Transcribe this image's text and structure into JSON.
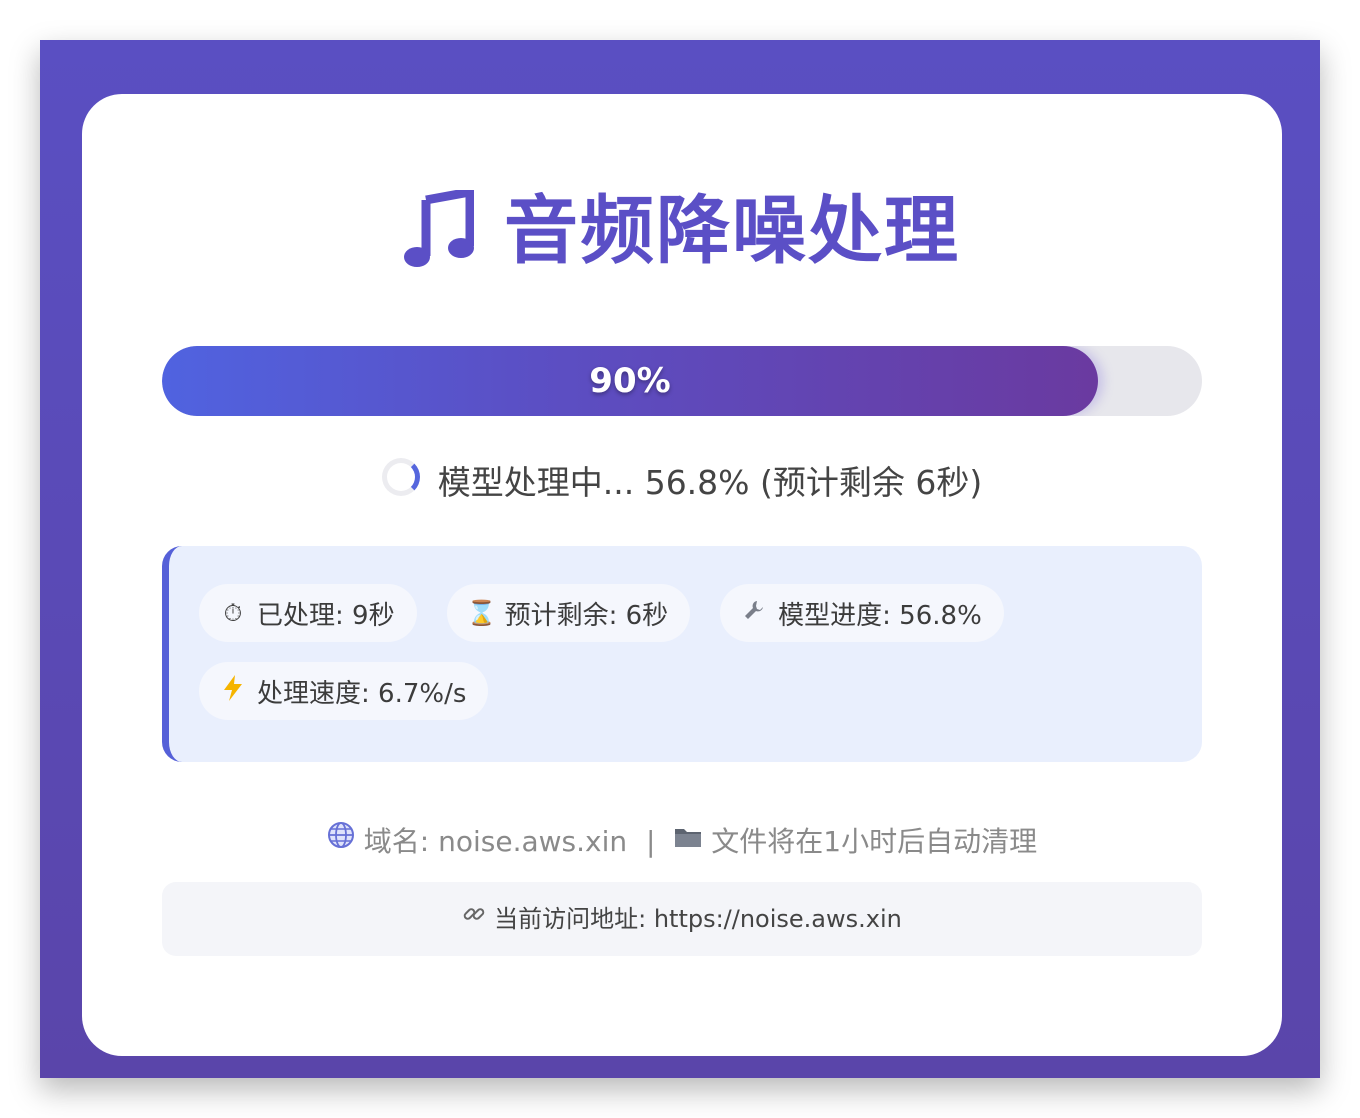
{
  "app": {
    "title": "音频降噪处理",
    "title_icon": "music-note-icon",
    "accent_color": "#5b4fc6"
  },
  "progress": {
    "percent": 90,
    "label": "90%"
  },
  "status": {
    "text": "模型处理中... 56.8% (预计剩余 6秒)"
  },
  "stats": [
    {
      "icon": "stopwatch-icon",
      "label": "已处理: 9秒"
    },
    {
      "icon": "hourglass-icon",
      "label": "预计剩余: 6秒"
    },
    {
      "icon": "wrench-icon",
      "label": "模型进度: 56.8%"
    },
    {
      "icon": "lightning-icon",
      "label": "处理速度: 6.7%/s"
    }
  ],
  "footer": {
    "domain_text": "域名: noise.aws.xin",
    "separator": "|",
    "cleanup_text": "文件将在1小时后自动清理"
  },
  "url_box": {
    "text": "当前访问地址: https://noise.aws.xin"
  }
}
